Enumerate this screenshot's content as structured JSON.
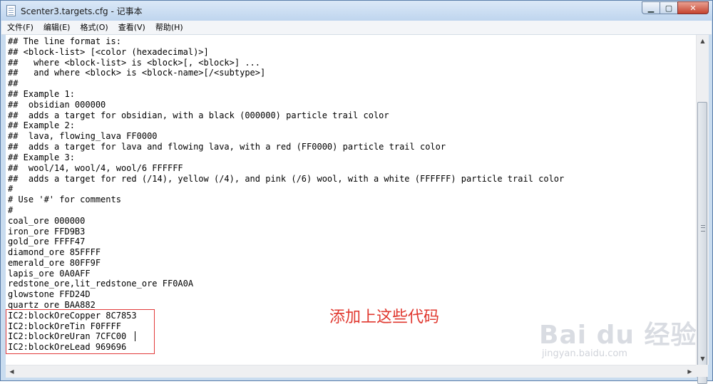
{
  "window": {
    "title": "Scenter3.targets.cfg - 记事本",
    "minimize_glyph": "▁",
    "maximize_glyph": "▢",
    "close_glyph": "✕"
  },
  "menu": [
    {
      "label": "文件(F)"
    },
    {
      "label": "编辑(E)"
    },
    {
      "label": "格式(O)"
    },
    {
      "label": "查看(V)"
    },
    {
      "label": "帮助(H)"
    }
  ],
  "editor": {
    "lines": [
      "## The line format is:",
      "## <block-list> [<color (hexadecimal)>]",
      "##   where <block-list> is <block>[, <block>] ...",
      "##   and where <block> is <block-name>[/<subtype>]",
      "##",
      "## Example 1:",
      "##  obsidian 000000",
      "##  adds a target for obsidian, with a black (000000) particle trail color",
      "## Example 2:",
      "##  lava, flowing_lava FF0000",
      "##  adds a target for lava and flowing lava, with a red (FF0000) particle trail color",
      "## Example 3:",
      "##  wool/14, wool/4, wool/6 FFFFFF",
      "##  adds a target for red (/14), yellow (/4), and pink (/6) wool, with a white (FFFFFF) particle trail color",
      "#",
      "# Use '#' for comments",
      "#",
      "coal_ore 000000",
      "iron_ore FFD9B3",
      "gold_ore FFFF47",
      "diamond_ore 85FFFF",
      "emerald_ore 80FF9F",
      "lapis_ore 0A0AFF",
      "redstone_ore,lit_redstone_ore FF0A0A",
      "glowstone FFD24D",
      "quartz_ore BAA882",
      "IC2:blockOreCopper 8C7853",
      "IC2:blockOreTin F0FFFF",
      "IC2:blockOreUran 7CFC00",
      "IC2:blockOreLead 969696"
    ]
  },
  "annotation": {
    "text": "添加上这些代码",
    "color": "#e0382f"
  },
  "watermark": {
    "logo": "Bai du 经验",
    "url": "jingyan.baidu.com"
  },
  "scrollbars": {
    "up_glyph": "▲",
    "down_glyph": "▼",
    "left_glyph": "◀",
    "right_glyph": "▶"
  },
  "colors": {
    "titlebar": "#c9dcef",
    "highlight_border": "#e23b3b"
  }
}
